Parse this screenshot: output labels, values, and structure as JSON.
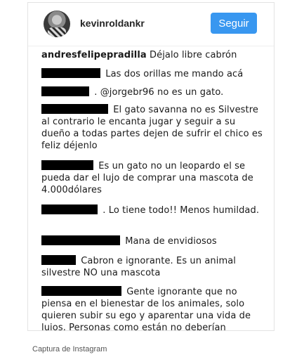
{
  "header": {
    "username": "kevinroldankr",
    "follow_label": "Seguir"
  },
  "comments": [
    {
      "author": "andresfelipepradilla",
      "text": "Déjalo libre cabrón",
      "author_redacted": false
    },
    {
      "text": "Las dos orillas me mando acá",
      "author_redacted": true
    },
    {
      "text": ". @jorgebr96 no es un gato.",
      "author_redacted": true
    },
    {
      "text": "El gato savanna no es Silvestre al contrario le encanta jugar y seguir a su dueño a todas partes dejen de sufrir el chico es feliz déjenlo",
      "author_redacted": true
    },
    {
      "text": "Es un gato no un leopardo el se pueda dar el lujo de comprar una mascota de 4.000dólares",
      "author_redacted": true
    },
    {
      "text": ". Lo tiene todo!! Menos humildad.",
      "author_redacted": true
    },
    {
      "text": "Mana de envidiosos",
      "author_redacted": true
    },
    {
      "text": "Cabron e ignorante. Es un animal silvestre NO una mascota",
      "author_redacted": true
    },
    {
      "text": "Gente ignorante que no piensa en el bienestar de los animales, solo quieren subir su ego y aparentar una vida de lujos. Personas como están no deberían",
      "author_redacted": true
    }
  ],
  "caption": "Captura de Instagram"
}
